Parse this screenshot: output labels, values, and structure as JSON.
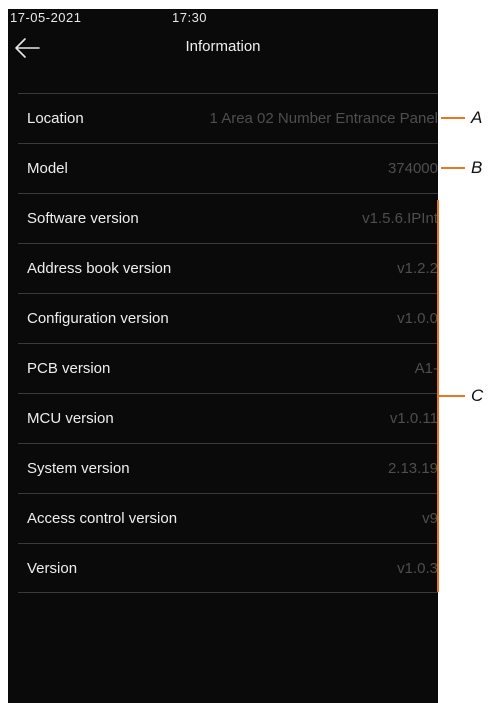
{
  "status_bar": {
    "date": "17-05-2021",
    "time": "17:30"
  },
  "header": {
    "title": "Information",
    "back_icon": "arrow-left-icon"
  },
  "rows": [
    {
      "label": "Location",
      "value": "1 Area 02 Number Entrance Panel"
    },
    {
      "label": "Model",
      "value": "374000"
    },
    {
      "label": "Software version",
      "value": "v1.5.6.IPInt"
    },
    {
      "label": "Address book version",
      "value": "v1.2.2"
    },
    {
      "label": "Configuration version",
      "value": "v1.0.0"
    },
    {
      "label": "PCB version",
      "value": "A1-"
    },
    {
      "label": "MCU version",
      "value": "v1.0.11"
    },
    {
      "label": "System version",
      "value": "2.13.19"
    },
    {
      "label": "Access control version",
      "value": "v9"
    },
    {
      "label": "Version",
      "value": "v1.0.3"
    }
  ],
  "callouts": {
    "a": "A",
    "b": "B",
    "c": "C"
  },
  "colors": {
    "callout_line": "#e87722",
    "background": "#0a0a0a",
    "value_text": "#4e4e4e"
  }
}
